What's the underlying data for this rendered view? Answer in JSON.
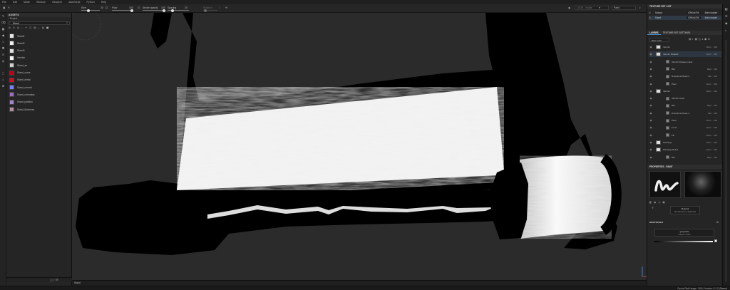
{
  "menu": [
    "File",
    "Edit",
    "Mode",
    "Window",
    "Viewport",
    "JavaScript",
    "Python",
    "Help"
  ],
  "toolbar": {
    "size_label": "Size",
    "size_value": "20",
    "flow_label": "Flow",
    "flow_value": "100",
    "stroke_opacity_label": "Stroke opacity",
    "stroke_opacity_value": "100",
    "spacing_label": "Spacing",
    "spacing_value": "20",
    "rotation_label": "Rotation",
    "rotation_value": "0",
    "camera_label": "LOOK - Inside",
    "view_mode": "Paint"
  },
  "assets": {
    "title": "ASSETS",
    "breadcrumb": "Project",
    "search_value": "Stand",
    "items": [
      {
        "label": "Stand1",
        "color": "#e8e8e8"
      },
      {
        "label": "Stand2",
        "color": "#f0f0f0"
      },
      {
        "label": "Stand3",
        "color": "#e0e0e0"
      },
      {
        "label": "Varnish",
        "color": "#f5f5f5"
      },
      {
        "label": "Stand_ao",
        "color": "#d0d0d0"
      },
      {
        "label": "Stand_curve",
        "color": "#c0001a"
      },
      {
        "label": "Stand_metal",
        "color": "#d01020"
      },
      {
        "label": "Stand_normal",
        "color": "#8080ff"
      },
      {
        "label": "Stand_normalws",
        "color": "#9a6fbf"
      },
      {
        "label": "Stand_position",
        "color": "#a088c8"
      },
      {
        "label": "Stand_thickness",
        "color": "#b090a0"
      }
    ],
    "footer_label": "Stand"
  },
  "texture_set_list": {
    "title": "TEXTURE SET LIST",
    "items": [
      {
        "name": "Scissor",
        "resolution": "4096x4096",
        "shader": "Main shader"
      },
      {
        "name": "Stand",
        "resolution": "4096x4096",
        "shader": "Main shader"
      }
    ]
  },
  "layers": {
    "tab_layers": "LAYERS",
    "tab_settings": "TEXTURE SET SETTINGS",
    "blend_selector": "Base color",
    "rows": [
      {
        "name": "Varnish",
        "mode": "Norm",
        "opacity": "100",
        "indent": 0
      },
      {
        "name": "Varnish Rotated",
        "mode": "Norm",
        "opacity": "100",
        "indent": 0
      },
      {
        "name": "Varnish Rotated mask",
        "mode": "",
        "opacity": "",
        "indent": 1
      },
      {
        "name": "Blur",
        "mode": "Repl",
        "opacity": "100",
        "indent": 1
      },
      {
        "name": "Directional Noise 2",
        "mode": "Mul",
        "opacity": "100",
        "indent": 1
      },
      {
        "name": "Paint",
        "mode": "Norm",
        "opacity": "100",
        "indent": 1
      },
      {
        "name": "Varnish",
        "mode": "Norm",
        "opacity": "100",
        "indent": 0
      },
      {
        "name": "Varnish mask",
        "mode": "",
        "opacity": "",
        "indent": 1
      },
      {
        "name": "Blur",
        "mode": "Repl",
        "opacity": "100",
        "indent": 1
      },
      {
        "name": "Directional Noise 2",
        "mode": "Mul",
        "opacity": "100",
        "indent": 1
      },
      {
        "name": "Paint",
        "mode": "Norm",
        "opacity": "100",
        "indent": 1
      },
      {
        "name": "Level",
        "mode": "Norm",
        "opacity": "100",
        "indent": 1
      },
      {
        "name": "Fill",
        "mode": "Norm",
        "opacity": "100",
        "indent": 1
      },
      {
        "name": "Paintings",
        "mode": "Norm",
        "opacity": "100",
        "indent": 0
      },
      {
        "name": "Paintings Relief",
        "mode": "Norm",
        "opacity": "100",
        "indent": 0
      },
      {
        "name": "Blur",
        "mode": "Repl",
        "opacity": "100",
        "indent": 1
      }
    ]
  },
  "properties": {
    "title": "PROPERTIES - PAINT",
    "material_label": "Material",
    "material_value": "No Resource Selected",
    "grayscale_title": "GRAYSCALE",
    "grayscale_label": "grayscale",
    "grayscale_sub": "uniform color"
  },
  "status": {
    "text": "Cache Disk Usage : 30% | Version: 9.1.2 (Steam)"
  },
  "colors": {
    "accent": "#3b8fd6",
    "viewport_bg": "#2b2b2b",
    "object": "#000000"
  }
}
